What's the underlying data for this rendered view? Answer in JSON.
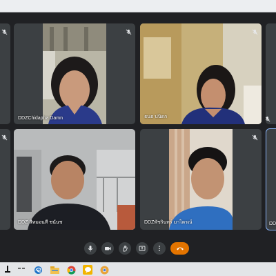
{
  "participants": [
    {
      "name": ""
    },
    {
      "name": "DDZChidapha Damn"
    },
    {
      "name": "ธนธ ปนิดก"
    },
    {
      "name": ""
    },
    {
      "name": ""
    },
    {
      "name": "DDZ สีหมอนที ชนันช"
    },
    {
      "name": "DDZพัชรินทร์ มาไตรณ์"
    },
    {
      "name": "DD"
    }
  ],
  "controls": {
    "icons": [
      "mic-icon",
      "camera-icon",
      "raise-hand-icon",
      "present-icon",
      "more-options-icon",
      "end-call-icon"
    ],
    "end_call_color": "#e37400"
  },
  "taskbar": {
    "icons": [
      "start-icon",
      "task-view-icon",
      "edge-icon",
      "file-explorer-icon",
      "chrome-icon",
      "line-icon",
      "chrome-canary-icon"
    ]
  },
  "colors": {
    "background": "#202124",
    "tile": "#3c4043",
    "active_outline": "#8ab4f8"
  }
}
